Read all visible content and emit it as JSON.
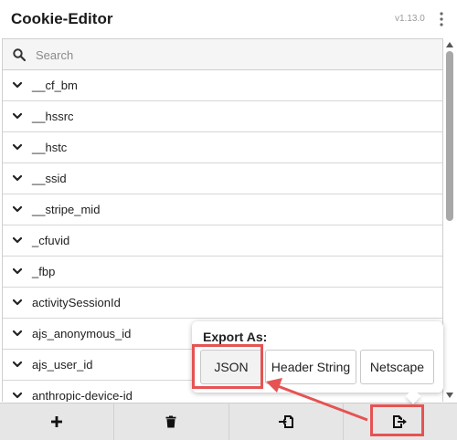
{
  "header": {
    "title": "Cookie-Editor",
    "version": "v1.13.0",
    "menu_icon": "kebab-menu-icon"
  },
  "search": {
    "placeholder": "Search",
    "value": "",
    "icon": "search-icon"
  },
  "cookies": [
    {
      "name": "__cf_bm"
    },
    {
      "name": "__hssrc"
    },
    {
      "name": "__hstc"
    },
    {
      "name": "__ssid"
    },
    {
      "name": "__stripe_mid"
    },
    {
      "name": "_cfuvid"
    },
    {
      "name": "_fbp"
    },
    {
      "name": "activitySessionId"
    },
    {
      "name": "ajs_anonymous_id"
    },
    {
      "name": "ajs_user_id"
    },
    {
      "name": "anthropic-device-id"
    }
  ],
  "export_popup": {
    "title": "Export As:",
    "options": [
      "JSON",
      "Header String",
      "Netscape"
    ]
  },
  "footer": {
    "buttons": [
      {
        "icon": "plus-icon"
      },
      {
        "icon": "trash-icon"
      },
      {
        "icon": "import-icon"
      },
      {
        "icon": "export-icon"
      }
    ]
  },
  "colors": {
    "highlight": "#e55353",
    "footer_bg": "#e6e6e6",
    "scrollbar_thumb": "#a8a8a8"
  }
}
